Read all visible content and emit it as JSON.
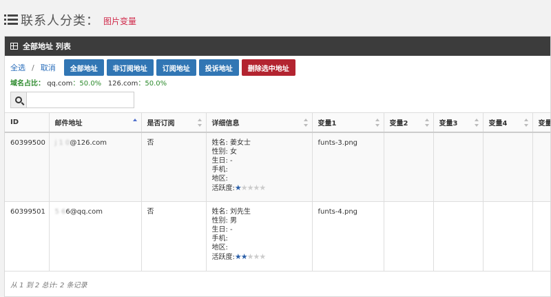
{
  "header": {
    "title": "联系人分类：",
    "subtitle": "图片变量"
  },
  "panel": {
    "title": "全部地址 列表"
  },
  "toolbar": {
    "select_all": "全选",
    "separator": "/",
    "cancel": "取消",
    "buttons": [
      "全部地址",
      "非订阅地址",
      "订阅地址",
      "投诉地址",
      "删除选中地址"
    ]
  },
  "domain_stats": {
    "label": "域名占比：",
    "qq_domain": "qq.com",
    "qq_pct": "：50.0%",
    "d126_domain": "126.com",
    "d126_pct": "：50.0%"
  },
  "search": {
    "placeholder": "",
    "value": ""
  },
  "table": {
    "columns": [
      "ID",
      "邮件地址",
      "是否订阅",
      "详细信息",
      "变量1",
      "变量2",
      "变量3",
      "变量4",
      "变量"
    ],
    "rows": [
      {
        "id": "60399500",
        "email_masked": "j  1  0",
        "email_suffix": "@126.com",
        "subscribed": "否",
        "name": "姓名: 姜女士",
        "gender": "性别: 女",
        "birthday": "生日: -",
        "phone": "手机:",
        "region": "地区:",
        "activity_label": "活跃度:",
        "activity_level": 1,
        "var1": "funts-3.png"
      },
      {
        "id": "60399501",
        "email_masked": "   5   6",
        "email_suffix": "6@qq.com",
        "subscribed": "否",
        "name": "姓名: 刘先生",
        "gender": "性别: 男",
        "birthday": "生日: -",
        "phone": "手机:",
        "region": "地区:",
        "activity_label": "活跃度:",
        "activity_level": 2,
        "var1": "funts-4.png"
      }
    ]
  },
  "footer": {
    "summary": "从 1 到 2 总计: 2 条记录"
  }
}
